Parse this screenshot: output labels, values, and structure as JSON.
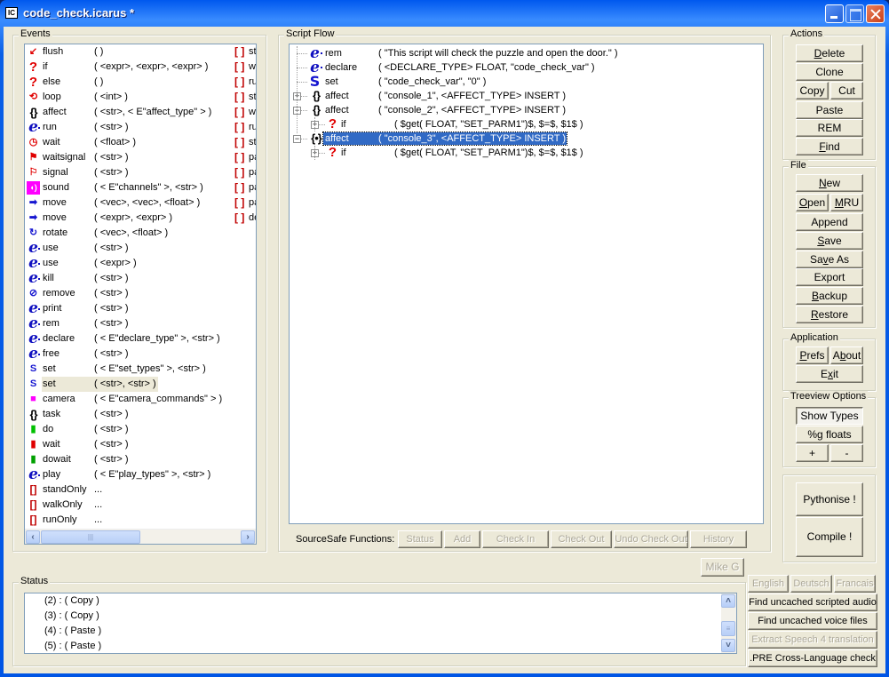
{
  "window": {
    "title": "code_check.icarus *",
    "app_icon_label": "IC"
  },
  "events": {
    "label": "Events",
    "items": [
      {
        "icon": "flush-icon",
        "glyph": "↙",
        "color": "#e00000",
        "name": "flush",
        "args": "(    )"
      },
      {
        "icon": "question-icon",
        "glyph": "?",
        "color": "#e00000",
        "name": "if",
        "args": "(  <expr>, <expr>, <expr>  )"
      },
      {
        "icon": "question-icon",
        "glyph": "?",
        "color": "#e00000",
        "name": "else",
        "args": "(    )"
      },
      {
        "icon": "loop-icon",
        "glyph": "⟲",
        "color": "#e00000",
        "name": "loop",
        "args": "(  <int>  )"
      },
      {
        "icon": "braces-icon",
        "glyph": "{}",
        "color": "#000000",
        "name": "affect",
        "args": "(  <str>, < E\"affect_type\" >  )"
      },
      {
        "icon": "e-icon",
        "glyph": "e",
        "color": "#1010c0",
        "name": "run",
        "args": "(  <str>  )"
      },
      {
        "icon": "clock-icon",
        "glyph": "◷",
        "color": "#e00000",
        "name": "wait",
        "args": "(  <float>  )"
      },
      {
        "icon": "waitsignal-icon",
        "glyph": "⚑",
        "color": "#e00000",
        "name": "waitsignal",
        "args": "(  <str>  )"
      },
      {
        "icon": "signal-icon",
        "glyph": "⚐",
        "color": "#e00000",
        "name": "signal",
        "args": "(  <str>  )"
      },
      {
        "icon": "sound-icon",
        "glyph": "◖)",
        "color": "#ff00ff",
        "name": "sound",
        "args": "(  < E\"channels\" >, <str>  )"
      },
      {
        "icon": "arrow-right-icon",
        "glyph": "➡",
        "color": "#1515d0",
        "name": "move",
        "args": "(  <vec>, <vec>, <float>  )"
      },
      {
        "icon": "arrow-right-icon",
        "glyph": "➡",
        "color": "#1515d0",
        "name": "move",
        "args": "(  <expr>, <expr>  )"
      },
      {
        "icon": "rotate-icon",
        "glyph": "↻",
        "color": "#1515d0",
        "name": "rotate",
        "args": "(  <vec>, <float>  )"
      },
      {
        "icon": "e-icon",
        "glyph": "e",
        "color": "#1010c0",
        "name": "use",
        "args": "(  <str>  )"
      },
      {
        "icon": "e-icon",
        "glyph": "e",
        "color": "#1010c0",
        "name": "use",
        "args": "(  <expr>  )"
      },
      {
        "icon": "e-icon",
        "glyph": "e",
        "color": "#1010c0",
        "name": "kill",
        "args": "(  <str>  )"
      },
      {
        "icon": "remove-icon",
        "glyph": "⊘",
        "color": "#1515d0",
        "name": "remove",
        "args": "(  <str>  )"
      },
      {
        "icon": "e-icon",
        "glyph": "e",
        "color": "#1010c0",
        "name": "print",
        "args": "(  <str>  )"
      },
      {
        "icon": "e-icon",
        "glyph": "e",
        "color": "#1010c0",
        "name": "rem",
        "args": "(  <str>  )"
      },
      {
        "icon": "e-icon",
        "glyph": "e",
        "color": "#1010c0",
        "name": "declare",
        "args": "(  < E\"declare_type\" >, <str>  )"
      },
      {
        "icon": "e-icon",
        "glyph": "e",
        "color": "#1010c0",
        "name": "free",
        "args": "(  <str>  )"
      },
      {
        "icon": "s-icon",
        "glyph": "S",
        "color": "#1515d0",
        "name": "set",
        "args": "(  < E\"set_types\" >, <str>  )"
      },
      {
        "icon": "s-icon",
        "glyph": "S",
        "color": "#1515d0",
        "name": "set",
        "args": "(  <str>, <str>  )",
        "selected": true
      },
      {
        "icon": "camera-icon",
        "glyph": "■",
        "color": "#ff00ff",
        "name": "camera",
        "args": "(  < E\"camera_commands\" >  )"
      },
      {
        "icon": "braces-icon",
        "glyph": "{}",
        "color": "#000000",
        "name": "task",
        "args": "(  <str>  )"
      },
      {
        "icon": "do-icon",
        "glyph": "▮",
        "color": "#00c000",
        "name": "do",
        "args": "(  <str>  )"
      },
      {
        "icon": "wait-task-icon",
        "glyph": "▮",
        "color": "#e00000",
        "name": "wait",
        "args": "(  <str>  )"
      },
      {
        "icon": "dowait-icon",
        "glyph": "▮",
        "color": "#00a000",
        "name": "dowait",
        "args": "(  <str>  )"
      },
      {
        "icon": "e-icon",
        "glyph": "e",
        "color": "#1010c0",
        "name": "play",
        "args": "(  < E\"play_types\" >, <str>  )"
      },
      {
        "icon": "brackets-icon",
        "glyph": "[]",
        "color": "#c00000",
        "name": "standOnly",
        "args": "..."
      },
      {
        "icon": "brackets-icon",
        "glyph": "[]",
        "color": "#c00000",
        "name": "walkOnly",
        "args": "..."
      },
      {
        "icon": "brackets-icon",
        "glyph": "[]",
        "color": "#c00000",
        "name": "runOnly",
        "args": "..."
      }
    ],
    "side_items": [
      "st",
      "w",
      "ru",
      "st",
      "w",
      "ru",
      "st",
      "pa",
      "pa",
      "pa",
      "pa",
      "de"
    ]
  },
  "script_flow": {
    "label": "Script Flow",
    "nodes": [
      {
        "icon": "e-icon",
        "glyph": "e",
        "name": "rem",
        "args": "(  \"This script will check the puzzle and open the door.\"  )",
        "level": 0,
        "expander": null
      },
      {
        "icon": "e-icon",
        "glyph": "e",
        "name": "declare",
        "args": "(  <DECLARE_TYPE> FLOAT, \"code_check_var\"  )",
        "level": 0,
        "expander": null
      },
      {
        "icon": "s-icon",
        "glyph": "S",
        "name": "set",
        "args": "(  \"code_check_var\", \"0\"  )",
        "level": 0,
        "expander": null
      },
      {
        "icon": "braces-icon",
        "glyph": "{}",
        "name": "affect",
        "args": "(  \"console_1\", <AFFECT_TYPE> INSERT  )",
        "level": 0,
        "expander": "+"
      },
      {
        "icon": "braces-icon",
        "glyph": "{}",
        "name": "affect",
        "args": "(  \"console_2\", <AFFECT_TYPE> INSERT  )",
        "level": 0,
        "expander": "-"
      },
      {
        "icon": "question-icon",
        "glyph": "?",
        "name": "if",
        "args": "(  $get( FLOAT, \"SET_PARM1\")$, $=$, $1$  )",
        "level": 1,
        "expander": "+"
      },
      {
        "icon": "braces-active-icon",
        "glyph": "{•}",
        "name": "affect",
        "args": "(  \"console_3\", <AFFECT_TYPE> INSERT  )",
        "level": 0,
        "expander": "-",
        "selected": true
      },
      {
        "icon": "question-icon",
        "glyph": "?",
        "name": "if",
        "args": "(  $get( FLOAT, \"SET_PARM1\")$, $=$, $1$  )",
        "level": 1,
        "expander": "+"
      }
    ]
  },
  "sourcesafe": {
    "label": "SourceSafe Functions:",
    "buttons": [
      "Status",
      "Add",
      "Check In",
      "Check Out",
      "Undo Check Out",
      "History"
    ]
  },
  "user_button": "Mike G",
  "actions": {
    "label": "Actions",
    "delete": "Delete",
    "clone": "Clone",
    "copy": "Copy",
    "cut": "Cut",
    "paste": "Paste",
    "rem": "REM",
    "find": "Find"
  },
  "file": {
    "label": "File",
    "new": "New",
    "open": "Open",
    "mru": "MRU",
    "append": "Append",
    "save": "Save",
    "save_as": "Save As",
    "export": "Export",
    "backup": "Backup",
    "restore": "Restore"
  },
  "application": {
    "label": "Application",
    "prefs": "Prefs",
    "about": "About",
    "exit": "Exit"
  },
  "treeview_options": {
    "label": "Treeview Options",
    "show_types": "Show Types",
    "g_floats": "%g floats",
    "plus": "+",
    "minus": "-"
  },
  "build": {
    "pythonise": "Pythonise !",
    "compile": "Compile !"
  },
  "status": {
    "label": "Status",
    "lines": [
      "(2) : ( Copy )",
      "(3) : ( Copy )",
      "(4) : ( Paste )",
      "(5) : ( Paste )"
    ]
  },
  "language": {
    "english": "English",
    "deutsch": "Deutsch",
    "francais": "Francais",
    "find_uncached_audio": "Find uncached scripted audio",
    "find_uncached_voice": "Find uncached voice files",
    "extract_speech": "Extract Speech 4 translation",
    "pre_check": ".PRE Cross-Language check"
  }
}
